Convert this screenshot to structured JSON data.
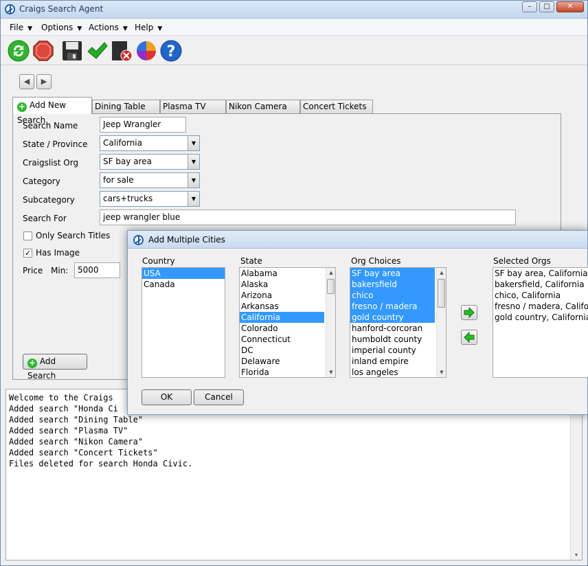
{
  "app": {
    "title": "Craigs Search Agent"
  },
  "menu": [
    {
      "label": "File"
    },
    {
      "label": "Options"
    },
    {
      "label": "Actions"
    },
    {
      "label": "Help"
    }
  ],
  "toolbar": {
    "icons": [
      "refresh-icon",
      "stop-icon",
      "save-icon",
      "checkmark-icon",
      "delete-file-icon",
      "color-wheel-icon",
      "help-icon"
    ]
  },
  "tabs": [
    {
      "label": "Add New Search"
    },
    {
      "label": "Dining Table"
    },
    {
      "label": "Plasma TV"
    },
    {
      "label": "Nikon Camera"
    },
    {
      "label": "Concert Tickets"
    }
  ],
  "form": {
    "search_name_label": "Search Name",
    "search_name_value": "Jeep Wrangler",
    "state_label": "State / Province",
    "state_value": "California",
    "org_label": "Craigslist Org",
    "org_value": "SF bay area",
    "category_label": "Category",
    "category_value": "for sale",
    "subcategory_label": "Subcategory",
    "subcategory_value": "cars+trucks",
    "search_for_label": "Search For",
    "search_for_value": "jeep wrangler blue",
    "only_titles_label": "Only Search Titles",
    "has_image_label": "Has Image",
    "price_label": "Price",
    "min_label": "Min:",
    "min_value": "5000",
    "add_search_label": "Add Search"
  },
  "log": {
    "lines": [
      "Welcome to the Craigs",
      "Added search \"Honda Ci",
      "Added search \"Dining Table\"",
      "Added search \"Plasma TV\"",
      "Added search \"Nikon Camera\"",
      "Added search \"Concert Tickets\"",
      "Files deleted for search Honda Civic."
    ]
  },
  "dialog": {
    "title": "Add Multiple Cities",
    "country_header": "Country",
    "countries": [
      "USA",
      "Canada"
    ],
    "state_header": "State",
    "states": [
      "Alabama",
      "Alaska",
      "Arizona",
      "Arkansas",
      "California",
      "Colorado",
      "Connecticut",
      "DC",
      "Delaware",
      "Florida"
    ],
    "org_header": "Org Choices",
    "orgs": [
      "SF bay area",
      "bakersfield",
      "chico",
      "fresno / madera",
      "gold country",
      "hanford-corcoran",
      "humboldt county",
      "imperial county",
      "inland empire",
      "los angeles"
    ],
    "selected_header": "Selected Orgs",
    "selected": [
      "SF bay area, California",
      "bakersfield, California",
      "chico, California",
      "fresno / madera, California",
      "gold country, California"
    ],
    "ok_label": "OK",
    "cancel_label": "Cancel"
  }
}
